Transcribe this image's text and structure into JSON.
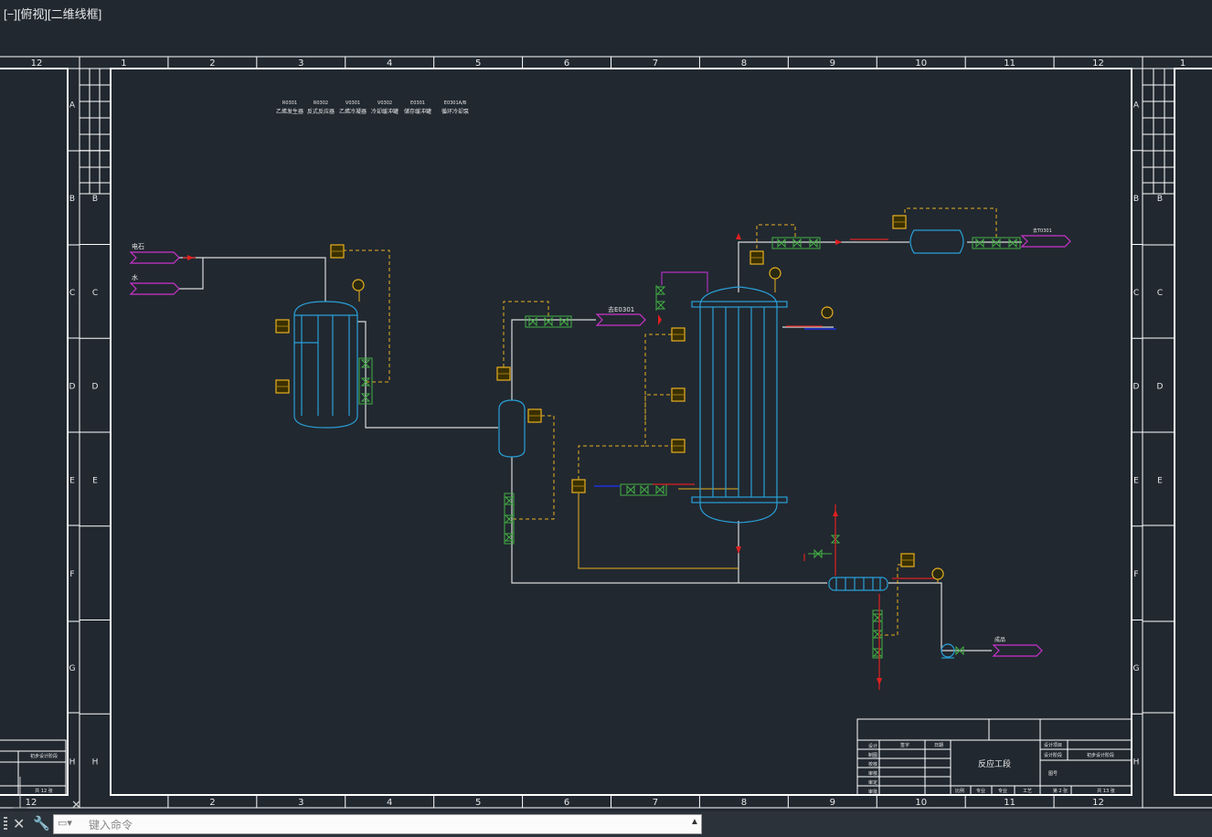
{
  "viewport": {
    "label": "[−][俯视][二维线框]"
  },
  "drawing": {
    "col_numbers_top": [
      "1",
      "2",
      "3",
      "4",
      "5",
      "6",
      "7",
      "8",
      "9",
      "10",
      "11",
      "12"
    ],
    "row_letters": [
      "A",
      "B",
      "C",
      "D",
      "E",
      "F",
      "G",
      "H"
    ],
    "left_sheet_col": "12",
    "right_sheet_col": "1",
    "equipment_tags": [
      {
        "tag": "R0301",
        "name": "乙烯发生器"
      },
      {
        "tag": "R0302",
        "name": "反式反应器"
      },
      {
        "tag": "V0301",
        "name": "乙烯冷凝器"
      },
      {
        "tag": "V0302",
        "name": "冷却缓冲罐"
      },
      {
        "tag": "E0301",
        "name": "储存缓冲罐"
      },
      {
        "tag": "E0301A/B",
        "name": "循环冷却泵"
      }
    ],
    "stream_labels": {
      "feed_1": "电石",
      "feed_2": "水",
      "to_e0301": "去E0301",
      "to_t0301": "去T0301",
      "product": "成品"
    },
    "title_block": {
      "title": "反应工段",
      "design_project": "设计项目",
      "design_stage_label": "设计阶段",
      "design_stage_value": "初步设计阶段",
      "drawing_no_label": "图号",
      "sheet_info": "第 2 张",
      "total_info": "共 13 张",
      "left_sheet_total": "共 12 张",
      "left_stage": "初步设计阶段",
      "rows": [
        "设计",
        "制图",
        "校核",
        "审核",
        "审定",
        "审批"
      ],
      "col_heads": [
        "签字",
        "日期"
      ],
      "bottom_cells": [
        "比例",
        "专业",
        "专业",
        "工艺"
      ]
    }
  },
  "command_line": {
    "placeholder": "键入命令",
    "icons": [
      "grip-icon",
      "close-icon",
      "wrench-icon",
      "prompt-icon",
      "history-arrow-icon"
    ]
  },
  "colors": {
    "background": "#212830",
    "frame": "#ffffff",
    "pipe": "#d9d9d9",
    "equipment": "#2a9fd6",
    "signal": "#e8b020",
    "valve": "#44b044",
    "offpage": "#cc33cc",
    "red_line": "#e02020",
    "blue_line": "#2030e0"
  }
}
